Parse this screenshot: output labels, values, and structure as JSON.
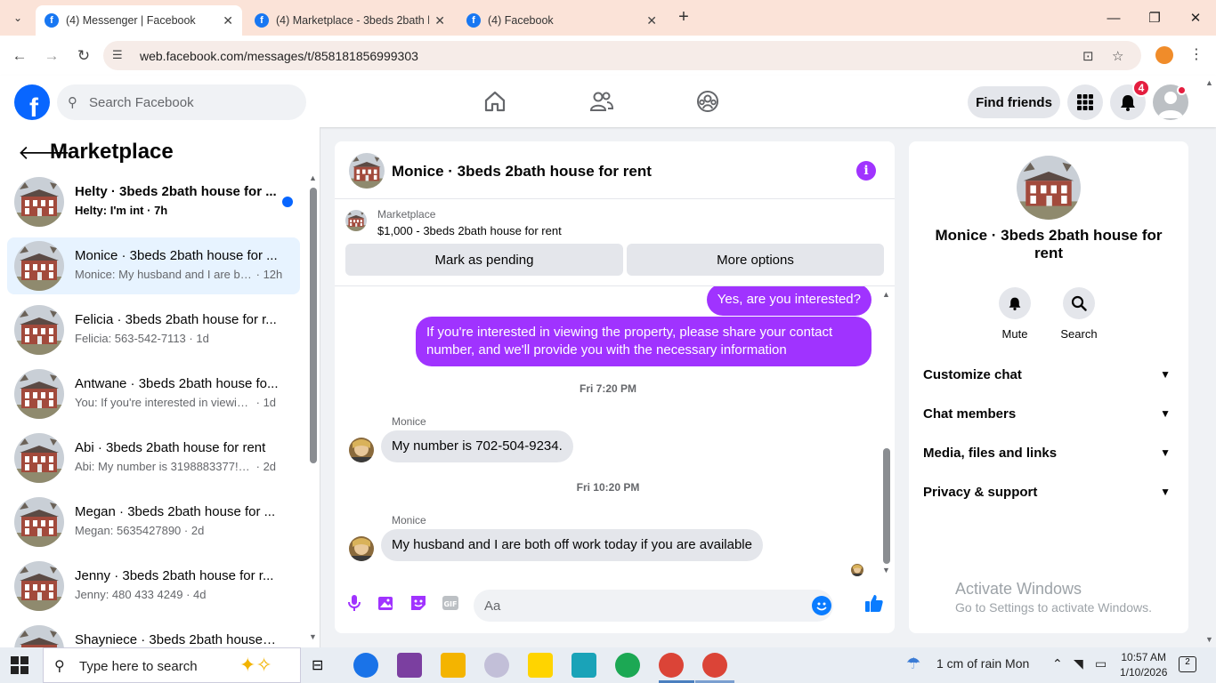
{
  "browser": {
    "tabs": [
      {
        "title": "(4) Messenger | Facebook",
        "active": true
      },
      {
        "title": "(4) Marketplace - 3beds 2bath h",
        "active": false
      },
      {
        "title": "(4) Facebook",
        "active": false
      }
    ],
    "url": "web.facebook.com/messages/t/858181856999303"
  },
  "fb_header": {
    "search_placeholder": "Search Facebook",
    "find_friends": "Find friends",
    "notification_count": "4",
    "colors": {
      "brand": "#0866ff",
      "badge": "#e41e3f"
    }
  },
  "left_panel": {
    "title": "Marketplace",
    "conversations": [
      {
        "title": "Helty · 3beds 2bath house for ...",
        "snippet": "Helty: I'm int",
        "time": "· 7h",
        "unread": true
      },
      {
        "title": "Monice · 3beds 2bath house for ...",
        "snippet": "Monice: My husband and I are bo...",
        "time": "· 12h",
        "selected": true
      },
      {
        "title": "Felicia · 3beds 2bath house for r...",
        "snippet": "Felicia: 563-542-7113",
        "time": "· 1d"
      },
      {
        "title": "Antwane · 3beds 2bath house fo...",
        "snippet": "You: If you're interested in viewing ...",
        "time": "· 1d"
      },
      {
        "title": "Abi · 3beds 2bath house for rent",
        "snippet": "Abi: My number is 3198883377! Lo...",
        "time": "· 2d"
      },
      {
        "title": "Megan · 3beds 2bath house for ...",
        "snippet": "Megan: 5635427890",
        "time": "· 2d"
      },
      {
        "title": "Jenny · 3beds 2bath house for r...",
        "snippet": "Jenny: 480 433 4249",
        "time": "· 4d"
      },
      {
        "title": "Shayniece · 3beds 2bath house f...",
        "snippet": "",
        "time": ""
      }
    ]
  },
  "chat": {
    "title": "Monice · 3beds 2bath house for rent",
    "marketplace_label": "Marketplace",
    "listing": "$1,000 - 3beds 2bath house for rent",
    "mark_pending": "Mark as pending",
    "more_options": "More options",
    "messages": {
      "out1": "Yes, are you interested?",
      "out2": "If you're interested in viewing the property, please share your contact number, and we'll provide you with the necessary information",
      "ts1": "Fri 7:20 PM",
      "sender1": "Monice",
      "in1": "My number is 702-504-9234.",
      "ts2": "Fri 10:20 PM",
      "sender2": "Monice",
      "in2": "My husband and I are both off work today if you are available"
    },
    "composer_placeholder": "Aa",
    "accent": "#a033ff"
  },
  "info_panel": {
    "name": "Monice · 3beds 2bath house for rent",
    "mute": "Mute",
    "search": "Search",
    "sections": [
      "Customize chat",
      "Chat members",
      "Media, files and links",
      "Privacy & support"
    ]
  },
  "watermark": {
    "line1": "Activate Windows",
    "line2": "Go to Settings to activate Windows."
  },
  "taskbar": {
    "search_placeholder": "Type here to search",
    "weather": "1 cm of rain Mon",
    "time": "10:57 AM",
    "date": "1/10/2026",
    "notif_count": "2"
  }
}
